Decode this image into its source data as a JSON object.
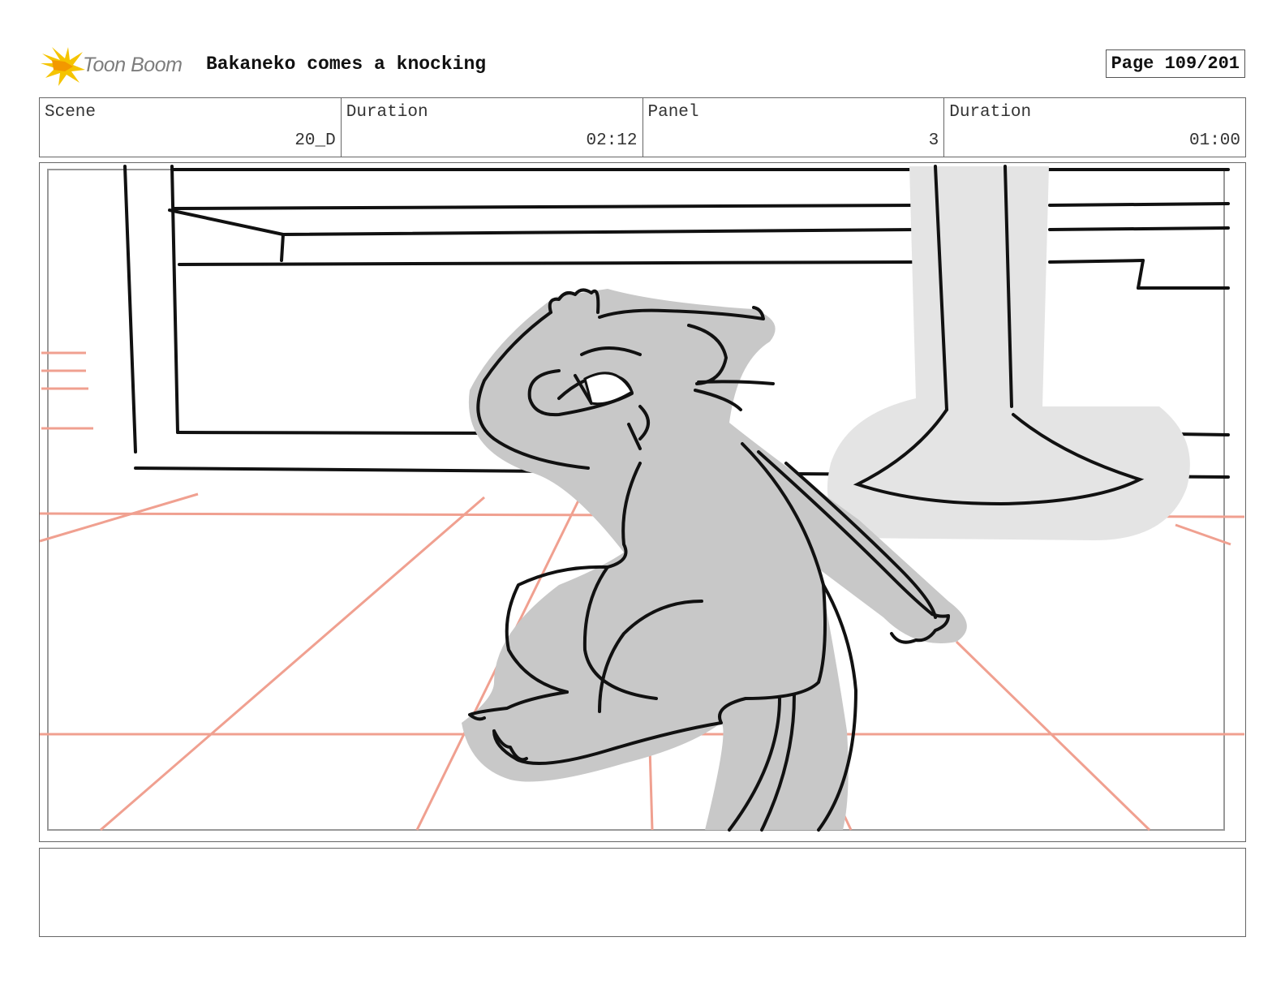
{
  "header": {
    "logo_text": "Toon Boom",
    "title": "Bakaneko comes a knocking",
    "page": "Page 109/201"
  },
  "info": {
    "scene_label": "Scene",
    "scene_value": "20_D",
    "scene_duration_label": "Duration",
    "scene_duration_value": "02:12",
    "panel_label": "Panel",
    "panel_value": "3",
    "panel_duration_label": "Duration",
    "panel_duration_value": "01:00"
  },
  "notes": {
    "text": ""
  },
  "colors": {
    "accent_logo": "#f5c400",
    "floor_lines": "#f0a090",
    "ink": "#111111",
    "fill_gray": "#c8c8c8"
  }
}
